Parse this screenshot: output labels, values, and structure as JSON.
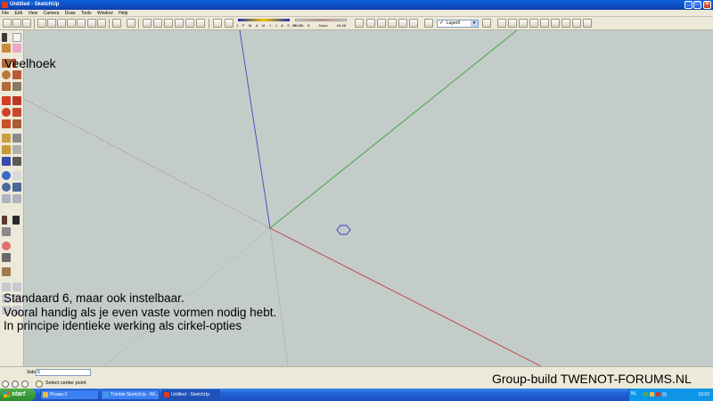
{
  "window": {
    "title": "Untitled - SketchUp"
  },
  "menu": [
    "File",
    "Edit",
    "View",
    "Camera",
    "Draw",
    "Tools",
    "Window",
    "Help"
  ],
  "shadow_settings": {
    "months_label": "J F M A M J J A S O N D",
    "time_start": "06:43",
    "time_noon": "Noon",
    "time_end": "04:46"
  },
  "layer": {
    "current": "Layer0"
  },
  "canvas": {
    "title": "Veelhoek",
    "lines": [
      "Standaard 6, maar ook instelbaar.",
      "Vooral handig als je even vaste vormen nodig hebt.",
      "In principe identieke werking als cirkel-opties"
    ],
    "axis_colors": {
      "red": "#c0383c",
      "green": "#3ca03c",
      "blue": "#3c48c0"
    }
  },
  "measurements": {
    "label": "Sides",
    "value": "6"
  },
  "status": {
    "text": "Select center point"
  },
  "watermark": "Group-build TWENOT-FORUMS.NL",
  "taskbar": {
    "start": "start",
    "tasks": [
      "Picasa 3",
      "Trimble SketchUp - Wi...",
      "Untitled - SketchUp"
    ],
    "lang": "NL",
    "clock": "10:03"
  }
}
